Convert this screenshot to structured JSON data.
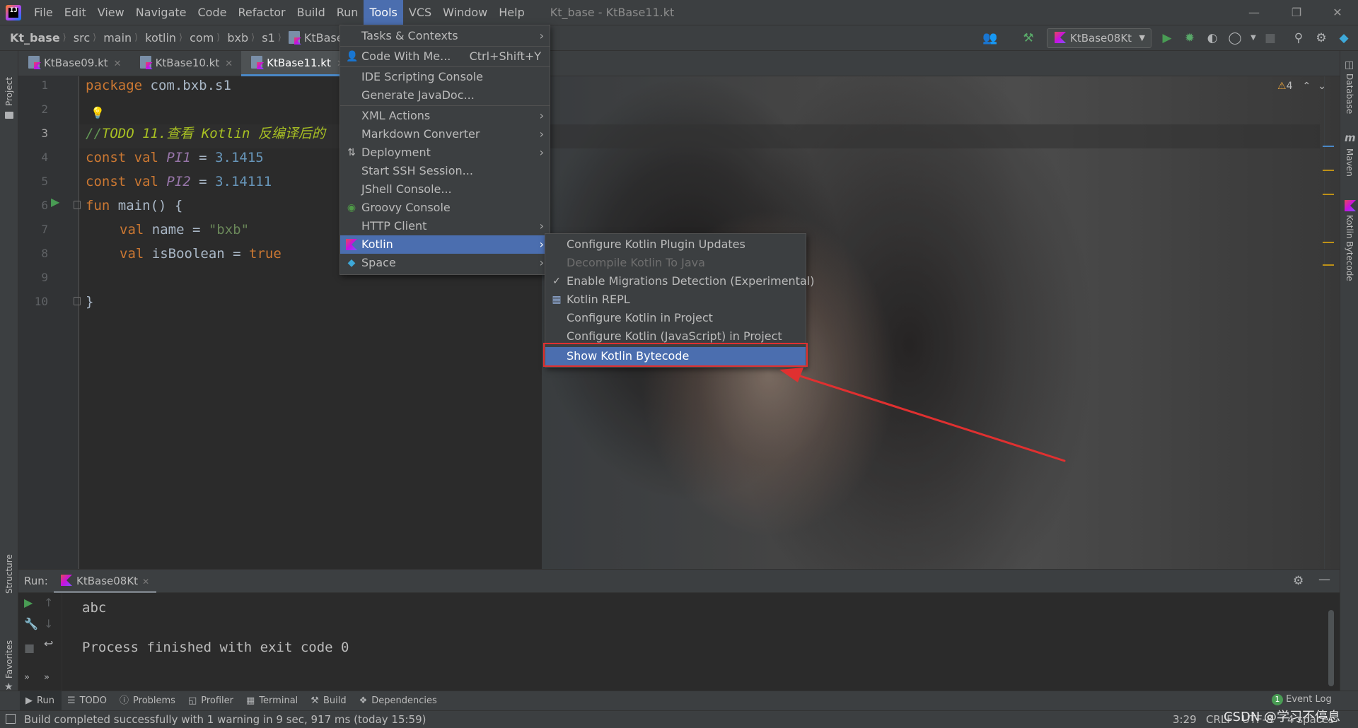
{
  "menubar": {
    "items": [
      "File",
      "Edit",
      "View",
      "Navigate",
      "Code",
      "Refactor",
      "Build",
      "Run",
      "Tools",
      "VCS",
      "Window",
      "Help"
    ],
    "active_index": 8,
    "window_title": "Kt_base - KtBase11.kt"
  },
  "breadcrumb": [
    "Kt_base",
    "src",
    "main",
    "kotlin",
    "com",
    "bxb",
    "s1",
    "KtBase11."
  ],
  "toolbar": {
    "run_config": "KtBase08Kt"
  },
  "tabs": [
    {
      "label": "KtBase09.kt",
      "active": false
    },
    {
      "label": "KtBase10.kt",
      "active": false
    },
    {
      "label": "KtBase11.kt",
      "active": true
    }
  ],
  "editor": {
    "line_numbers": [
      "1",
      "2",
      "3",
      "4",
      "5",
      "6",
      "7",
      "8",
      "9",
      "10"
    ],
    "current_line": "3",
    "warnings": "4",
    "lines": {
      "l1_kw": "package",
      "l1_pkg": " com.bxb.s1",
      "l3_prefix": "//",
      "l3_todo": "TODO 11.查看 Kotlin 反编译后的",
      "l4_const": "const",
      "l4_val": " val ",
      "l4_name": "PI1",
      "l4_eq": " = ",
      "l4_num": "3.1415",
      "l5_const": "const",
      "l5_val": " val ",
      "l5_name": "PI2",
      "l5_eq": " = ",
      "l5_num": "3.14111",
      "l6_fun": "fun",
      "l6_rest": " main() {",
      "l7_val": "val",
      "l7_name": " name",
      "l7_eq": " = ",
      "l7_str": "\"bxb\"",
      "l8_val": "val",
      "l8_name": " isBoolean",
      "l8_eq": " = ",
      "l8_true": "true",
      "l10_close": "}"
    }
  },
  "tools_menu": [
    {
      "label": "Tasks & Contexts",
      "submenu": true
    },
    {
      "label": "Code With Me...",
      "shortcut": "Ctrl+Shift+Y"
    },
    {
      "label": "IDE Scripting Console"
    },
    {
      "label": "Generate JavaDoc..."
    },
    {
      "label": "XML Actions",
      "submenu": true
    },
    {
      "label": "Markdown Converter",
      "submenu": true
    },
    {
      "label": "Deployment",
      "submenu": true
    },
    {
      "label": "Start SSH Session..."
    },
    {
      "label": "JShell Console..."
    },
    {
      "label": "Groovy Console"
    },
    {
      "label": "HTTP Client",
      "submenu": true
    },
    {
      "label": "Kotlin",
      "submenu": true,
      "selected": true
    },
    {
      "label": "Space",
      "submenu": true
    }
  ],
  "kotlin_submenu": [
    {
      "label": "Configure Kotlin Plugin Updates"
    },
    {
      "label": "Decompile Kotlin To Java",
      "disabled": true
    },
    {
      "label": "Enable Migrations Detection (Experimental)",
      "checked": true
    },
    {
      "label": "Kotlin REPL"
    },
    {
      "label": "Configure Kotlin in Project"
    },
    {
      "label": "Configure Kotlin (JavaScript) in Project"
    },
    {
      "label": "Show Kotlin Bytecode",
      "selected": true
    }
  ],
  "side_tabs": {
    "left": [
      "Project",
      "Structure",
      "Favorites"
    ],
    "right": [
      "Database",
      "Maven",
      "Kotlin Bytecode"
    ]
  },
  "run_panel": {
    "label": "Run:",
    "tab": "KtBase08Kt",
    "output": [
      "abc",
      "",
      "Process finished with exit code 0"
    ]
  },
  "tool_windows": [
    "Run",
    "TODO",
    "Problems",
    "Profiler",
    "Terminal",
    "Build",
    "Dependencies"
  ],
  "event_log": {
    "count": "1",
    "label": "Event Log"
  },
  "status": {
    "message": "Build completed successfully with 1 warning in 9 sec, 917 ms (today 15:59)",
    "position": "3:29",
    "line_sep": "CRLF",
    "encoding": "UTF-8",
    "indent": "4 spaces",
    "watermark": "CSDN @学习不停息"
  },
  "colors": {
    "accent": "#4b6eaf",
    "annotation_red": "#e03030",
    "keyword": "#cc7832",
    "number": "#6897bb",
    "string": "#6a8759"
  }
}
